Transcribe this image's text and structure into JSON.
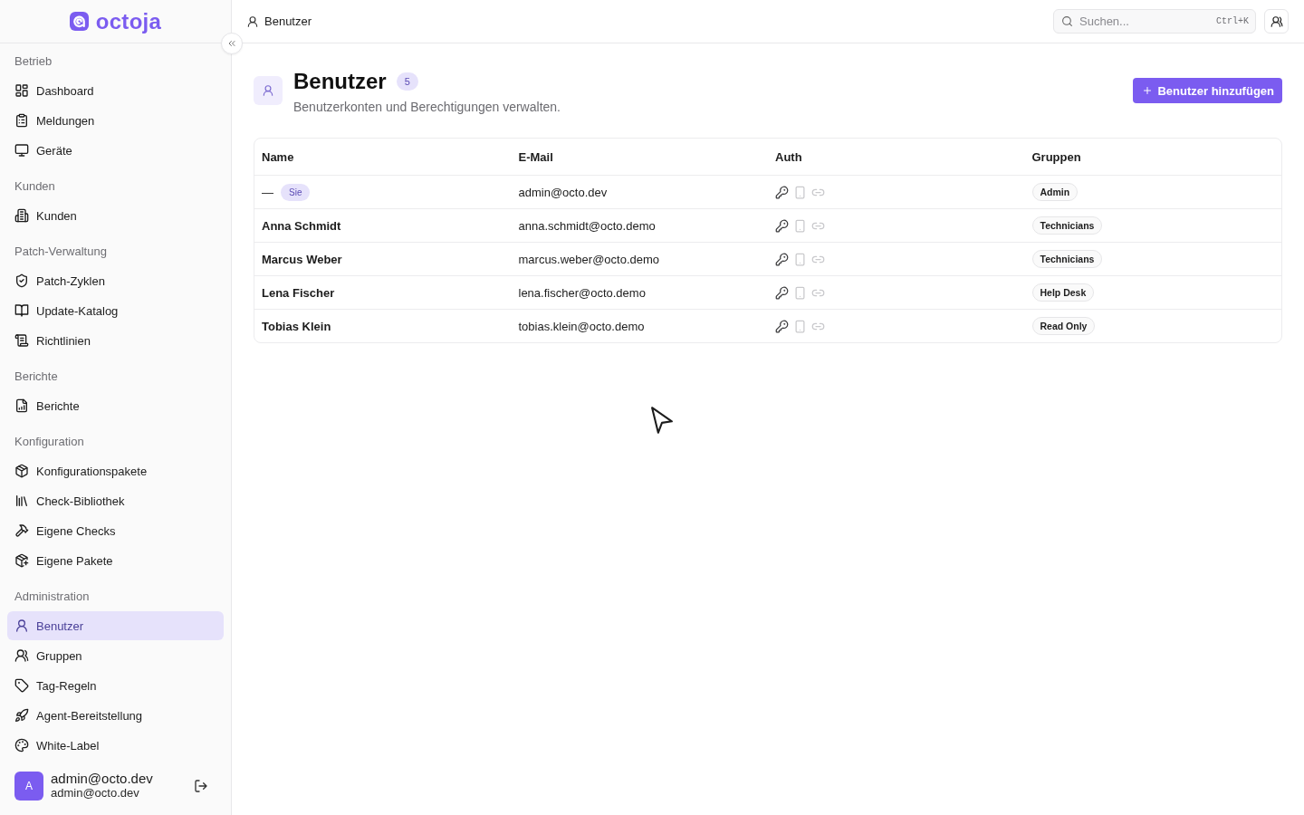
{
  "sidebar": {
    "logo": "octoja",
    "sections": [
      {
        "title": "Betrieb",
        "items": [
          {
            "label": "Dashboard",
            "selected": false
          },
          {
            "label": "Meldungen",
            "selected": false
          },
          {
            "label": "Geräte",
            "selected": false
          }
        ]
      },
      {
        "title": "Kunden",
        "items": [
          {
            "label": "Kunden",
            "selected": false
          }
        ]
      },
      {
        "title": "Patch-Verwaltung",
        "items": [
          {
            "label": "Patch-Zyklen",
            "selected": false
          },
          {
            "label": "Update-Katalog",
            "selected": false
          },
          {
            "label": "Richtlinien",
            "selected": false
          }
        ]
      },
      {
        "title": "Berichte",
        "items": [
          {
            "label": "Berichte",
            "selected": false
          }
        ]
      },
      {
        "title": "Konfiguration",
        "items": [
          {
            "label": "Konfigurationspakete",
            "selected": false
          },
          {
            "label": "Check-Bibliothek",
            "selected": false
          },
          {
            "label": "Eigene Checks",
            "selected": false
          },
          {
            "label": "Eigene Pakete",
            "selected": false
          }
        ]
      },
      {
        "title": "Administration",
        "items": [
          {
            "label": "Benutzer",
            "selected": true
          },
          {
            "label": "Gruppen",
            "selected": false
          },
          {
            "label": "Tag-Regeln",
            "selected": false
          },
          {
            "label": "Agent-Bereitstellung",
            "selected": false
          },
          {
            "label": "White-Label",
            "selected": false
          }
        ]
      }
    ],
    "user": {
      "avatar": "A",
      "name": "admin@octo.dev",
      "email": "admin@octo.dev"
    }
  },
  "header": {
    "breadcrumb": "Benutzer",
    "search": {
      "placeholder": "Suchen...",
      "shortcut": "Ctrl+K"
    }
  },
  "page": {
    "title": "Benutzer",
    "count": "5",
    "subtitle": "Benutzerkonten und Berechtigungen verwalten.",
    "add_button": "Benutzer hinzufügen"
  },
  "table": {
    "columns": [
      "Name",
      "E-Mail",
      "Auth",
      "Gruppen"
    ],
    "rows": [
      {
        "name": "—",
        "badge": "Sie",
        "email": "admin@octo.dev",
        "auth": [
          {
            "kind": "key",
            "on": true
          },
          {
            "kind": "phone",
            "on": false
          },
          {
            "kind": "link",
            "on": false
          }
        ],
        "group": "Admin"
      },
      {
        "name": "Anna Schmidt",
        "email": "anna.schmidt@octo.demo",
        "auth": [
          {
            "kind": "key",
            "on": true
          },
          {
            "kind": "phone",
            "on": false
          },
          {
            "kind": "link",
            "on": false
          }
        ],
        "group": "Technicians"
      },
      {
        "name": "Marcus Weber",
        "email": "marcus.weber@octo.demo",
        "auth": [
          {
            "kind": "key",
            "on": true
          },
          {
            "kind": "phone",
            "on": false
          },
          {
            "kind": "link",
            "on": false
          }
        ],
        "group": "Technicians"
      },
      {
        "name": "Lena Fischer",
        "email": "lena.fischer@octo.demo",
        "auth": [
          {
            "kind": "key",
            "on": true
          },
          {
            "kind": "phone",
            "on": false
          },
          {
            "kind": "link",
            "on": false
          }
        ],
        "group": "Help Desk"
      },
      {
        "name": "Tobias Klein",
        "email": "tobias.klein@octo.demo",
        "auth": [
          {
            "kind": "key",
            "on": true
          },
          {
            "kind": "phone",
            "on": false
          },
          {
            "kind": "link",
            "on": false
          }
        ],
        "group": "Read Only"
      }
    ]
  }
}
